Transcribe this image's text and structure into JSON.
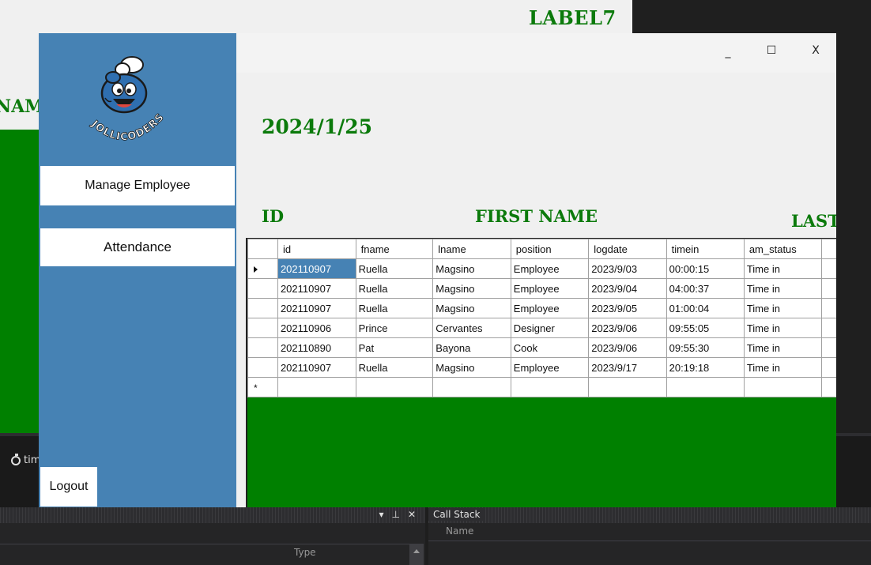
{
  "background_form": {
    "label7": "LABEL7",
    "name_label": "NAMI",
    "timer_label": "tim"
  },
  "app": {
    "sidebar": {
      "logo_text": "JOLLICODERS",
      "manage_employee": "Manage Employee",
      "attendance": "Attendance",
      "logout": "Logout"
    },
    "window_controls": {
      "minimize": "_",
      "maximize": "☐",
      "close": "X"
    },
    "date": "2024/1/25",
    "labels": {
      "id": "ID",
      "first_name": "FIRST NAME",
      "last": "LAST"
    },
    "grid": {
      "columns": [
        "id",
        "fname",
        "lname",
        "position",
        "logdate",
        "timein",
        "am_status"
      ],
      "rows": [
        [
          "202110907",
          "Ruella",
          "Magsino",
          "Employee",
          "2023/9/03",
          "00:00:15",
          "Time in"
        ],
        [
          "202110907",
          "Ruella",
          "Magsino",
          "Employee",
          "2023/9/04",
          "04:00:37",
          "Time in"
        ],
        [
          "202110907",
          "Ruella",
          "Magsino",
          "Employee",
          "2023/9/05",
          "01:00:04",
          "Time in"
        ],
        [
          "202110906",
          "Prince",
          "Cervantes",
          "Designer",
          "2023/9/06",
          "09:55:05",
          "Time in"
        ],
        [
          "202110890",
          "Pat",
          "Bayona",
          "Cook",
          "2023/9/06",
          "09:55:30",
          "Time in"
        ],
        [
          "202110907",
          "Ruella",
          "Magsino",
          "Employee",
          "2023/9/17",
          "20:19:18",
          "Time in"
        ]
      ],
      "new_row_marker": "*"
    }
  },
  "ide": {
    "call_stack_title": "Call Stack",
    "name_column": "Name",
    "type_column": "Type"
  },
  "colors": {
    "sidebar": "#4682b4",
    "green_panel": "#008000",
    "label_green": "#0b7a0b"
  }
}
